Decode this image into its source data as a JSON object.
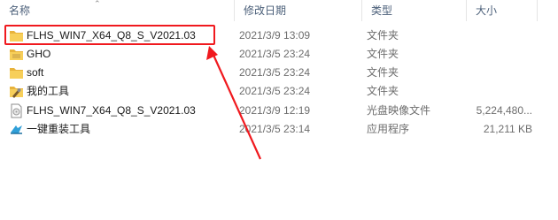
{
  "columns": {
    "name": "名称",
    "date": "修改日期",
    "type": "类型",
    "size": "大小"
  },
  "files": [
    {
      "name": "FLHS_WIN7_X64_Q8_S_V2021.03",
      "date": "2021/3/9 13:09",
      "type": "文件夹",
      "size": "",
      "icon": "folder-icon"
    },
    {
      "name": "GHO",
      "date": "2021/3/5 23:24",
      "type": "文件夹",
      "size": "",
      "icon": "folder-icon"
    },
    {
      "name": "soft",
      "date": "2021/3/5 23:24",
      "type": "文件夹",
      "size": "",
      "icon": "folder-icon"
    },
    {
      "name": "我的工具",
      "date": "2021/3/5 23:24",
      "type": "文件夹",
      "size": "",
      "icon": "tools-folder-icon"
    },
    {
      "name": "FLHS_WIN7_X64_Q8_S_V2021.03",
      "date": "2021/3/9 12:19",
      "type": "光盘映像文件",
      "size": "5,224,480...",
      "icon": "disc-image-icon"
    },
    {
      "name": "一键重装工具",
      "date": "2021/3/5 23:14",
      "type": "应用程序",
      "size": "21,211 KB",
      "icon": "installer-app-icon"
    }
  ],
  "colors": {
    "annotation": "#f0191e",
    "folder": "#f7cf5a"
  }
}
